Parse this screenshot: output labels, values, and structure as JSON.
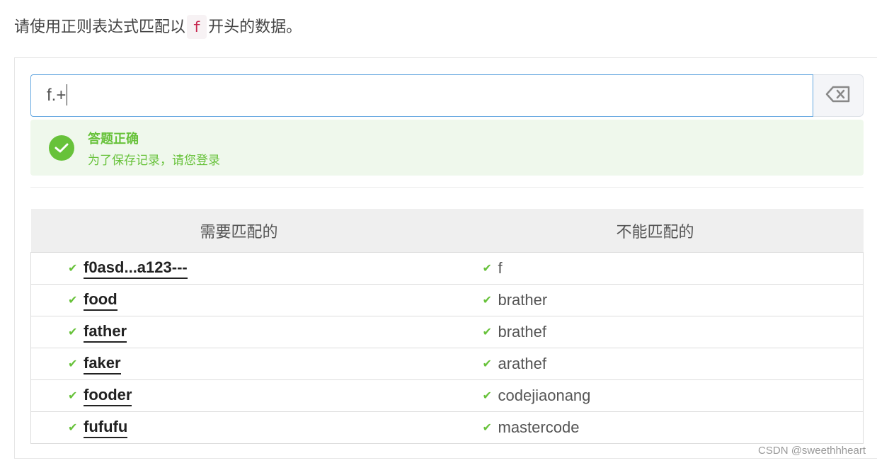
{
  "prompt": {
    "before": "请使用正则表达式匹配以",
    "code": "f",
    "after": "开头的数据。"
  },
  "input": {
    "value": "f.+",
    "clear_icon": "backspace-clear-icon"
  },
  "result": {
    "icon": "check-circle-icon",
    "title": "答题正确",
    "subtitle": "为了保存记录，请您登录",
    "color": "#67c23a"
  },
  "table": {
    "headers": [
      "需要匹配的",
      "不能匹配的"
    ],
    "rows": [
      {
        "match": "f0asd...a123---",
        "nomatch": "f"
      },
      {
        "match": "food",
        "nomatch": "brather"
      },
      {
        "match": "father",
        "nomatch": "brathef"
      },
      {
        "match": "faker",
        "nomatch": "arathef"
      },
      {
        "match": "fooder",
        "nomatch": "codejiaonang"
      },
      {
        "match": "fufufu",
        "nomatch": "mastercode"
      }
    ],
    "check_icon": "check-icon",
    "check_color": "#67c23a"
  },
  "watermark": "CSDN @sweethhheart"
}
